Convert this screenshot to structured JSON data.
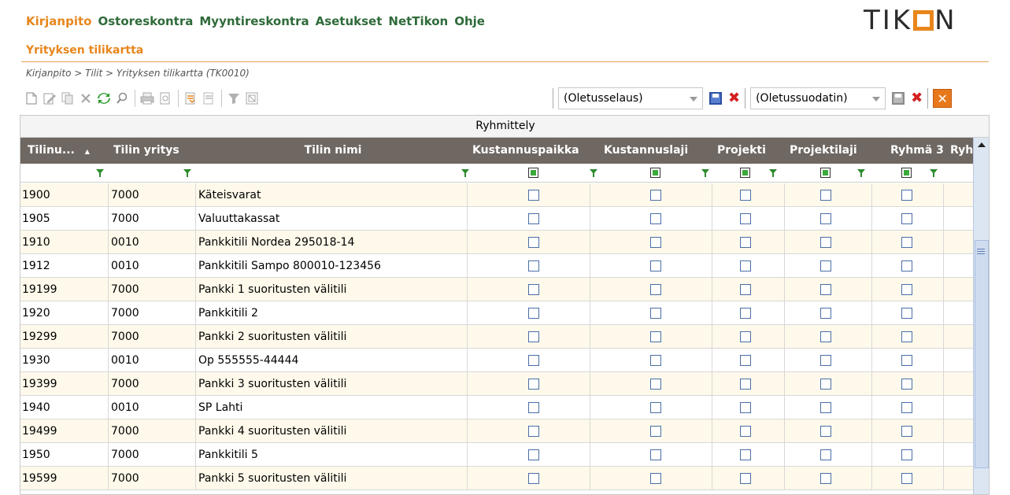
{
  "nav": [
    {
      "label": "Kirjanpito",
      "active": true
    },
    {
      "label": "Ostoreskontra",
      "active": false
    },
    {
      "label": "Myyntireskontra",
      "active": false
    },
    {
      "label": "Asetukset",
      "active": false
    },
    {
      "label": "NetTikon",
      "active": false
    },
    {
      "label": "Ohje",
      "active": false
    }
  ],
  "logo": {
    "left": "TIK",
    "right": "N"
  },
  "page_title": "Yrityksen tilikartta",
  "breadcrumb": "Kirjanpito > Tilit > Yrityksen tilikartta  (TK0010)",
  "toolbar_icons": [
    "new-document-icon",
    "edit-icon",
    "copy-icon",
    "delete-icon",
    "refresh-icon",
    "search-icon",
    "print-icon",
    "print-preview-icon",
    "import-icon",
    "export-icon",
    "filter-icon",
    "settings-icon"
  ],
  "view_select": {
    "value": "(Oletusselaus)"
  },
  "filter_select": {
    "value": "(Oletussuodatin)"
  },
  "close_label": "✕",
  "grid": {
    "group_label": "Ryhmittely",
    "columns": {
      "tilinumero": "Tilinu...",
      "sort_indicator": "▲",
      "yritys": "Tilin yritys",
      "nimi": "Tilin nimi",
      "kustannuspaikka": "Kustannuspaikka",
      "kustannuslaji": "Kustannuslaji",
      "projekti": "Projekti",
      "projektilaji": "Projektilaji",
      "ryhma3": "Ryhmä 3",
      "ryhma4": "Ryh"
    },
    "rows": [
      {
        "tilinumero": "1900",
        "yritys": "7000",
        "nimi": "Käteisvarat"
      },
      {
        "tilinumero": "1905",
        "yritys": "7000",
        "nimi": "Valuuttakassat"
      },
      {
        "tilinumero": "1910",
        "yritys": "0010",
        "nimi": "Pankkitili Nordea 295018-14"
      },
      {
        "tilinumero": "1912",
        "yritys": "0010",
        "nimi": "Pankkitili Sampo 800010-123456"
      },
      {
        "tilinumero": "19199",
        "yritys": "7000",
        "nimi": "Pankki 1 suoritusten välitili"
      },
      {
        "tilinumero": "1920",
        "yritys": "7000",
        "nimi": "Pankkitili 2"
      },
      {
        "tilinumero": "19299",
        "yritys": "7000",
        "nimi": "Pankki  2 suoritusten välitili"
      },
      {
        "tilinumero": "1930",
        "yritys": "0010",
        "nimi": "Op 555555-44444"
      },
      {
        "tilinumero": "19399",
        "yritys": "7000",
        "nimi": "Pankki 3 suoritusten välitili"
      },
      {
        "tilinumero": "1940",
        "yritys": "0010",
        "nimi": "SP Lahti"
      },
      {
        "tilinumero": "19499",
        "yritys": "7000",
        "nimi": "Pankki 4 suoritusten välitili"
      },
      {
        "tilinumero": "1950",
        "yritys": "7000",
        "nimi": "Pankkitili 5"
      },
      {
        "tilinumero": "19599",
        "yritys": "7000",
        "nimi": "Pankki 5 suoritusten välitili"
      }
    ]
  },
  "colors": {
    "accent": "#e8861c",
    "nav": "#2f6b3a",
    "header_bg": "#6e6762",
    "alt_row": "#fef9ea"
  }
}
